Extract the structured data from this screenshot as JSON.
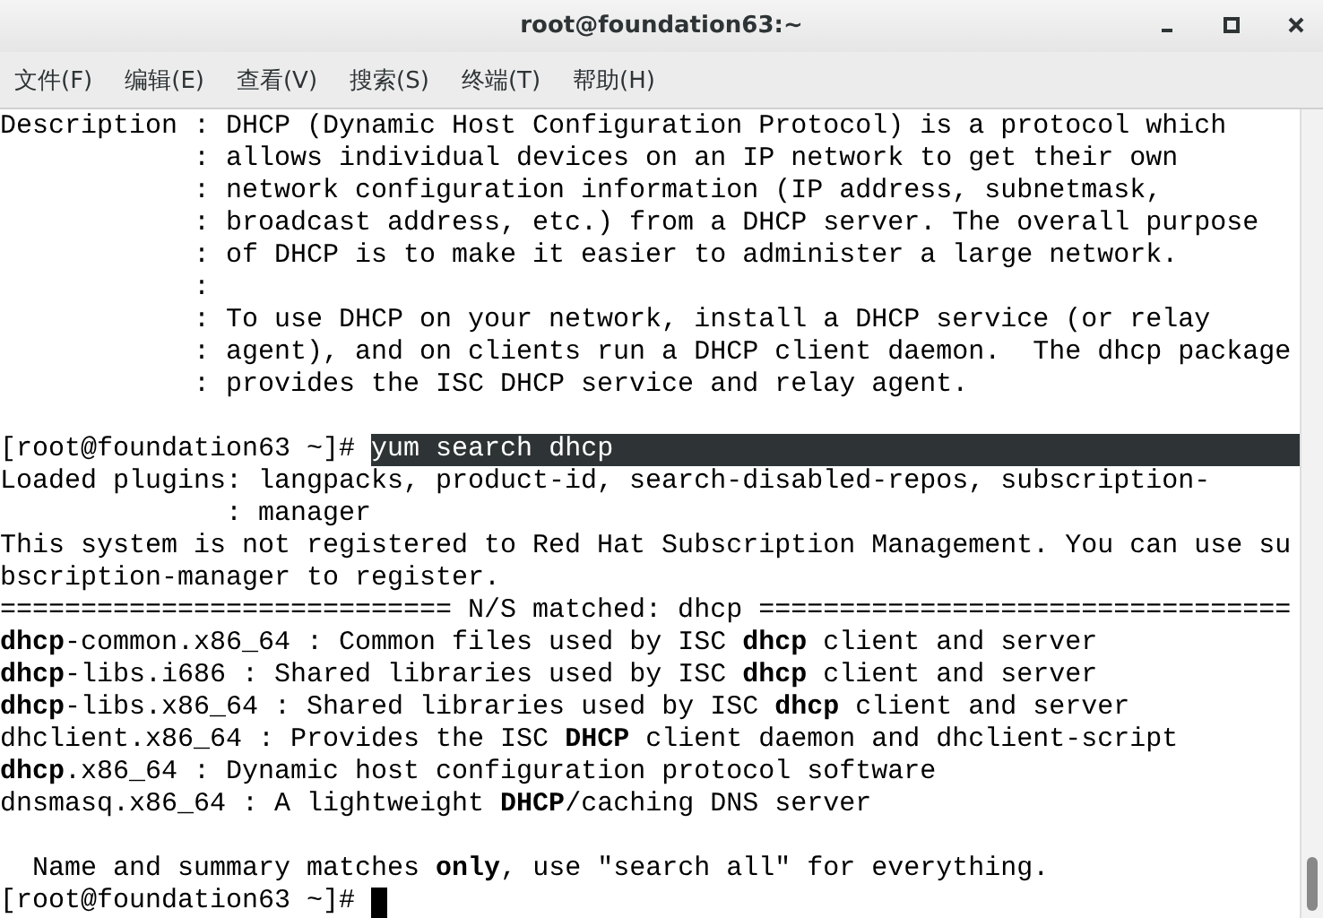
{
  "window": {
    "title": "root@foundation63:~"
  },
  "menu": [
    "文件(F)",
    "编辑(E)",
    "查看(V)",
    "搜索(S)",
    "终端(T)",
    "帮助(H)"
  ],
  "terminal": {
    "lines": [
      {
        "kind": "text",
        "text": "Description : DHCP (Dynamic Host Configuration Protocol) is a protocol which"
      },
      {
        "kind": "text",
        "text": "            : allows individual devices on an IP network to get their own"
      },
      {
        "kind": "text",
        "text": "            : network configuration information (IP address, subnetmask,"
      },
      {
        "kind": "text",
        "text": "            : broadcast address, etc.) from a DHCP server. The overall purpose"
      },
      {
        "kind": "text",
        "text": "            : of DHCP is to make it easier to administer a large network."
      },
      {
        "kind": "text",
        "text": "            :"
      },
      {
        "kind": "text",
        "text": "            : To use DHCP on your network, install a DHCP service (or relay"
      },
      {
        "kind": "text",
        "text": "            : agent), and on clients run a DHCP client daemon.  The dhcp package"
      },
      {
        "kind": "text",
        "text": "            : provides the ISC DHCP service and relay agent."
      },
      {
        "kind": "blank"
      },
      {
        "kind": "prompt",
        "prompt": "[root@foundation63 ~]#",
        "command": "yum search dhcp",
        "selected": true
      },
      {
        "kind": "text",
        "text": "Loaded plugins: langpacks, product-id, search-disabled-repos, subscription-"
      },
      {
        "kind": "text",
        "text": "              : manager"
      },
      {
        "kind": "text",
        "text": "This system is not registered to Red Hat Subscription Management. You can use su"
      },
      {
        "kind": "text",
        "text": "bscription-manager to register."
      },
      {
        "kind": "text",
        "text": "============================ N/S matched: dhcp ================================="
      },
      {
        "kind": "text",
        "text": "**dhcp**-common.x86_64 : Common files used by ISC **dhcp** client and server"
      },
      {
        "kind": "text",
        "text": "**dhcp**-libs.i686 : Shared libraries used by ISC **dhcp** client and server"
      },
      {
        "kind": "text",
        "text": "**dhcp**-libs.x86_64 : Shared libraries used by ISC **dhcp** client and server"
      },
      {
        "kind": "text",
        "text": "dhclient.x86_64 : Provides the ISC **DHCP** client daemon and dhclient-script"
      },
      {
        "kind": "text",
        "text": "**dhcp**.x86_64 : Dynamic host configuration protocol software"
      },
      {
        "kind": "text",
        "text": "dnsmasq.x86_64 : A lightweight **DHCP**/caching DNS server"
      },
      {
        "kind": "blank"
      },
      {
        "kind": "text",
        "text": "  Name and summary matches **only**, use \"search all\" for everything."
      },
      {
        "kind": "prompt",
        "prompt": "[root@foundation63 ~]#",
        "cursor": true
      }
    ]
  }
}
